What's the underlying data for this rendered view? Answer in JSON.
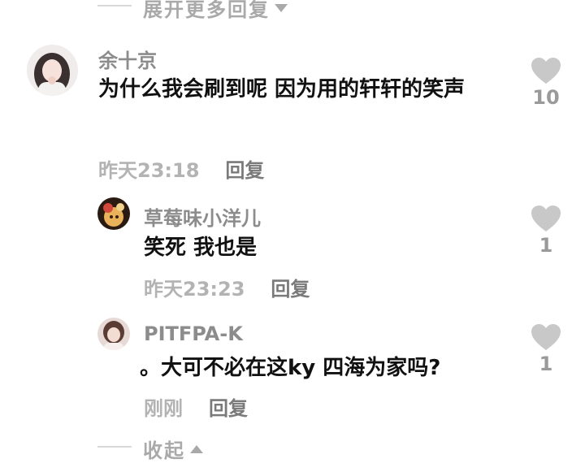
{
  "expand_more": {
    "label": "展开更多回复"
  },
  "collapse": {
    "label": "收起"
  },
  "comments": [
    {
      "username": "余十京",
      "text": "为什么我会刷到呢 因为用的轩轩的笑声",
      "time": "昨天23:18",
      "reply_label": "回复",
      "likes": "10"
    },
    {
      "username": "草莓味小洋儿",
      "text": "笑死 我也是",
      "time": "昨天23:23",
      "reply_label": "回复",
      "likes": "1"
    },
    {
      "username": "PITFPA-K",
      "text": "。大可不必在这ky 四海为家吗?",
      "time": "刚刚",
      "reply_label": "回复",
      "likes": "1"
    }
  ],
  "colors": {
    "like_heart": "#c8c8c8",
    "muted_text": "#a9a9a9",
    "primary_text": "#111111"
  }
}
